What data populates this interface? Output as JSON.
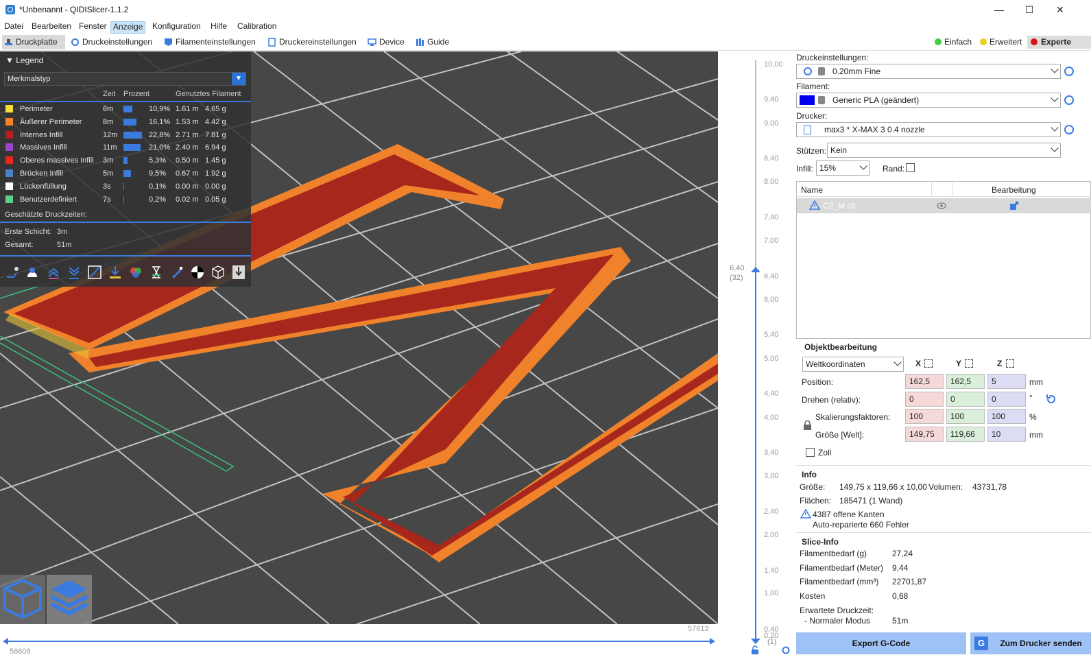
{
  "window": {
    "title": "*Unbenannt - QIDISlicer-1.1.2",
    "minimize": "—",
    "maximize": "☐",
    "close": "✕"
  },
  "menu": [
    "Datei",
    "Bearbeiten",
    "Fenster",
    "Anzeige",
    "Konfiguration",
    "Hilfe",
    "Calibration"
  ],
  "tabs": [
    "Druckplatte",
    "Druckeinstellungen",
    "Filamenteinstellungen",
    "Druckereinstellungen",
    "Device",
    "Guide"
  ],
  "modes": [
    {
      "label": "Einfach",
      "color": "#44cc44"
    },
    {
      "label": "Erweitert",
      "color": "#e8d020"
    },
    {
      "label": "Experte",
      "color": "#dd1111"
    }
  ],
  "legend": {
    "title": "Legend",
    "view_type": "Merkmalstyp",
    "headers": {
      "time": "Zeit",
      "percent": "Prozent",
      "filament": "Genutztes Filament"
    },
    "rows": [
      {
        "name": "Perimeter",
        "color": "#f5dd3a",
        "time": "6m",
        "pct": "10,9%",
        "len": "1.61 m",
        "g": "4.65 g",
        "frac": 0.109
      },
      {
        "name": "Äußerer Perimeter",
        "color": "#f5832a",
        "time": "8m",
        "pct": "16,1%",
        "len": "1.53 m",
        "g": "4.42 g",
        "frac": 0.161
      },
      {
        "name": "Internes Infill",
        "color": "#b32020",
        "time": "12m",
        "pct": "22,8%",
        "len": "2.71 m",
        "g": "7.81 g",
        "frac": 0.228
      },
      {
        "name": "Massives Infill",
        "color": "#9a47cc",
        "time": "11m",
        "pct": "21,0%",
        "len": "2.40 m",
        "g": "6.94 g",
        "frac": 0.21
      },
      {
        "name": "Oberes massives Infill",
        "color": "#e8281e",
        "time": "3m",
        "pct": "5,3%",
        "len": "0.50 m",
        "g": "1.45 g",
        "frac": 0.053
      },
      {
        "name": "Brücken Infill",
        "color": "#4d80c0",
        "time": "5m",
        "pct": "9,5%",
        "len": "0.67 m",
        "g": "1.92 g",
        "frac": 0.095
      },
      {
        "name": "Lückenfüllung",
        "color": "#ffffff",
        "time": "3s",
        "pct": "0,1%",
        "len": "0.00 m",
        "g": "0.00 g",
        "frac": 0.001
      },
      {
        "name": "Benutzerdefiniert",
        "color": "#5ed08a",
        "time": "7s",
        "pct": "0,2%",
        "len": "0.02 m",
        "g": "0.05 g",
        "frac": 0.002
      }
    ],
    "est_title": "Geschätzte Druckzeiten:",
    "first_layer_label": "Erste Schicht:",
    "first_layer": "3m",
    "total_label": "Gesamt:",
    "total": "51m"
  },
  "vslider": {
    "ticks": [
      "10,00",
      "9,40",
      "9,00",
      "8,40",
      "8,00",
      "7,40",
      "7,00",
      "6,40",
      "6,00",
      "5,40",
      "5,00",
      "4,40",
      "4,00",
      "3,40",
      "3,00",
      "2,40",
      "2,00",
      "1,40",
      "1,00",
      "0,40",
      "0,20"
    ],
    "current": "6,40",
    "current_layer": "(32)",
    "bottom_layer": "(1)"
  },
  "hslider": {
    "right": "57612",
    "left": "56608"
  },
  "panel": {
    "print_label": "Druckeinstellungen:",
    "print_value": "0.20mm Fine",
    "filament_label": "Filament:",
    "filament_value": "Generic PLA (geändert)",
    "filament_color": "#0000ee",
    "printer_label": "Drucker:",
    "printer_value": "max3 * X-MAX 3 0.4 nozzle",
    "supports_label": "Stützen:",
    "supports_value": "Kein",
    "infill_label": "Infill:",
    "infill_value": "15%",
    "brim_label": "Rand:",
    "list_name": "Name",
    "list_edit": "Bearbeitung",
    "object_name": "C2_M.stl",
    "obj_title": "Objektbearbeitung",
    "coord": "Weltkoordinaten",
    "axes": [
      "X",
      "Y",
      "Z"
    ],
    "position_label": "Position:",
    "position": [
      "162,5",
      "162,5",
      "5"
    ],
    "unit_mm": "mm",
    "rotate_label": "Drehen (relativ):",
    "rotate": [
      "0",
      "0",
      "0"
    ],
    "unit_deg": "°",
    "scale_label": "Skalierungsfaktoren:",
    "scale": [
      "100",
      "100",
      "100"
    ],
    "unit_pct": "%",
    "size_label": "Größe [Welt]:",
    "size": [
      "149,75",
      "119,66",
      "10"
    ],
    "inch_label": "Zoll",
    "info_title": "Info",
    "info_size_label": "Größe:",
    "info_size": "149,75 x 119,66 x 10,00",
    "info_vol_label": "Volumen:",
    "info_vol": "43731,78",
    "info_faces_label": "Flächen:",
    "info_faces": "185471 (1 Wand)",
    "warn1": "4387 offene Kanten",
    "warn2": "Auto-reparierte 660 Fehler",
    "slice_title": "Slice-Info",
    "slice_rows": [
      {
        "k": "Filamentbedarf (g)",
        "v": "27,24"
      },
      {
        "k": "Filamentbedarf (Meter)",
        "v": "9,44"
      },
      {
        "k": "Filamentbedarf (mm³)",
        "v": "22701,87"
      },
      {
        "k": "Kosten",
        "v": "0,68"
      }
    ],
    "eta_label": "Erwartete Druckzeit:",
    "eta_mode": "- Normaler Modus",
    "eta_value": "51m",
    "export_btn": "Export G-Code",
    "send_btn": "Zum Drucker senden"
  }
}
